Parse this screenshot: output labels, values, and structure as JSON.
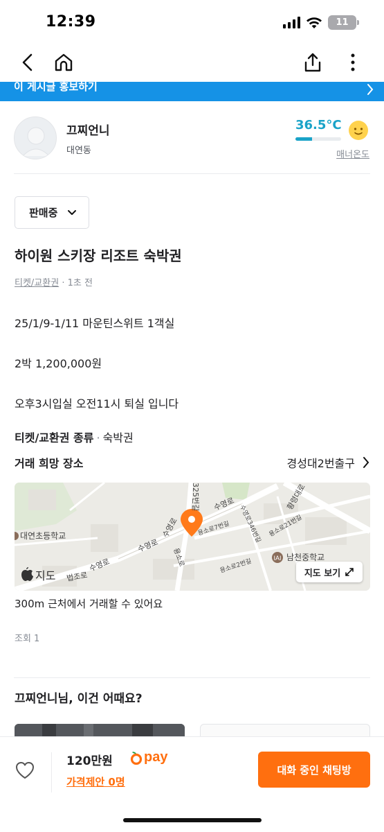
{
  "status_bar": {
    "time": "12:39",
    "battery": "11"
  },
  "promo": {
    "text": "이 게시글 홍보하기"
  },
  "seller": {
    "name": "끄찌언니",
    "region": "대연동",
    "temperature": "36.5°C",
    "temperature_level": 0.365,
    "manner_label": "매너온도"
  },
  "sale_status": {
    "selected": "판매중"
  },
  "listing": {
    "title": "하이원 스키장 리조트 숙박권",
    "category": "티켓/교환권",
    "time_ago": "1초 전",
    "description": [
      "25/1/9-1/11  마운틴스위트 1객실",
      "2박 1,200,000원",
      "오후3시입실 오전11시 퇴실 입니다"
    ],
    "spec_key": "티켓/교환권 종류",
    "spec_value": "숙박권"
  },
  "place": {
    "label": "거래 희망 장소",
    "value": "경성대2번출구",
    "map_button": "지도 보기",
    "map_watermark": "지도",
    "near_text": "300m 근처에서 거래할 수 있어요",
    "map_labels": {
      "school1": "대연초등학교",
      "school2": "남천중학교",
      "road1": "수영로",
      "road2": "수영로",
      "road3": "수영로",
      "road4": "수영로",
      "road5": "용소로",
      "road6": "용소로7번길",
      "road7": "용소로2번길",
      "road8": "황령대로",
      "road9": "325번길",
      "road10": "수영로346번길",
      "road11": "용소로21번길",
      "road12": "법조로"
    }
  },
  "views": "조회 1",
  "recommend": {
    "title": "끄찌언니님, 이건 어때요?"
  },
  "bottom": {
    "price": "120만원",
    "pay": "pay",
    "offer": "가격제안 0명",
    "chat_button": "대화 중인 채팅방"
  },
  "colors": {
    "accent": "#ff6f0f",
    "promo": "#1592e6",
    "temperature": "#1aa3c8"
  }
}
